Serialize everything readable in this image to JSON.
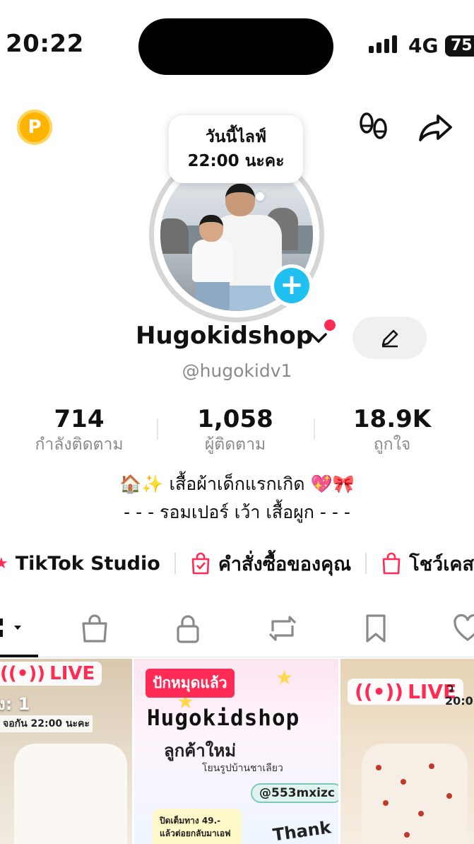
{
  "status_bar": {
    "time": "20:22",
    "network": "4G",
    "battery": "75"
  },
  "profile": {
    "live_bubble": {
      "line1": "วันนี้ไลฟ์",
      "line2": "22:00 นะคะ"
    },
    "display_name": "Hugokidshop",
    "username": "@hugokidv1",
    "stats": [
      {
        "value": "714",
        "label": "กำลังติดตาม"
      },
      {
        "value": "1,058",
        "label": "ผู้ติดตาม"
      },
      {
        "value": "18.9K",
        "label": "ถูกใจ"
      }
    ],
    "bio": [
      "🏠✨ เสื้อผ้าเด็กแรกเกิด 💖🎀",
      "- - - รอมเปอร์ เว้า เสื้อผูก - - -"
    ]
  },
  "shortcuts": [
    {
      "label": "TikTok Studio",
      "icon": "star-icon"
    },
    {
      "label": "คำสั่งซื้อของคุณ",
      "icon": "order-bag-icon"
    },
    {
      "label": "โชว์เคส",
      "icon": "shopping-bag-icon"
    }
  ],
  "tabs": [
    {
      "name": "videos-grid-icon",
      "active": true
    },
    {
      "name": "shop-bag-icon",
      "active": false
    },
    {
      "name": "private-lock-icon",
      "active": false
    },
    {
      "name": "repost-icon",
      "active": false
    },
    {
      "name": "saved-bookmark-icon",
      "active": false
    },
    {
      "name": "liked-heart-icon",
      "active": false
    }
  ],
  "videos": [
    {
      "live_label": "LIVE",
      "caption": "ง: 1",
      "subcaption": "จอกัน 22:00 นะคะ"
    },
    {
      "pinned_label": "ปักหมุดแล้ว",
      "title": "Hugokidshop",
      "subtitle": "ลูกค้าใหม่",
      "subtitle2": "โยนรูปบ้านชาเลียว",
      "handle": "@553mxizc",
      "note": "ปิดเต็มทาง 49.- แล้วต่อยกลับมาเอฟ",
      "thanks": "Thank"
    },
    {
      "live_label": "LIVE",
      "time_partial": "ว",
      "time": "20:0"
    }
  ],
  "colors": {
    "accent": "#ff2b55",
    "add_button": "#20c0f0",
    "points_coin": "#ffb400",
    "muted_text": "#8a8a8a"
  }
}
